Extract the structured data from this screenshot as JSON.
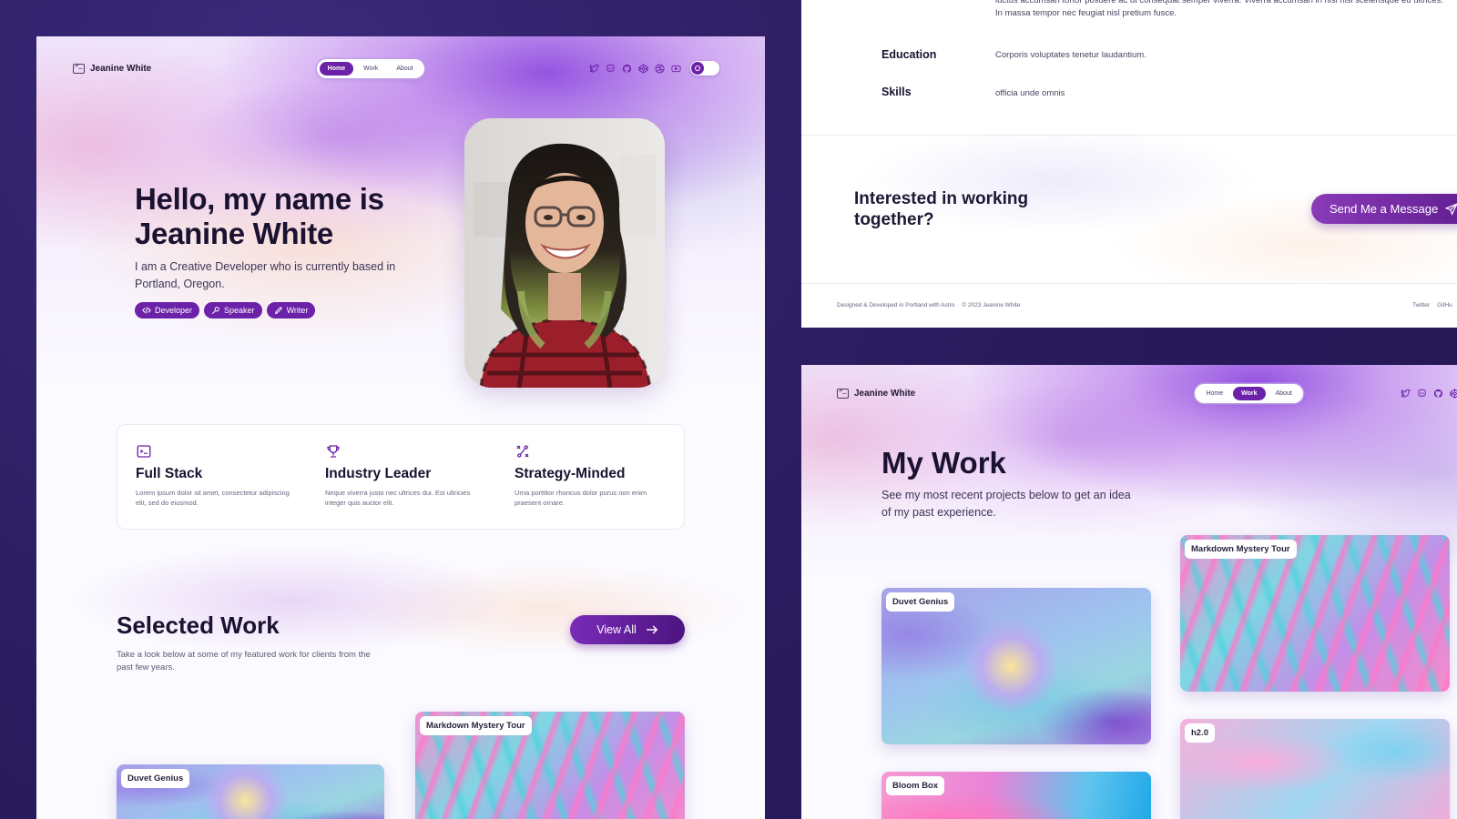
{
  "brand": {
    "name": "Jeanine White"
  },
  "nav": {
    "tabs": [
      "Home",
      "Work",
      "About"
    ]
  },
  "social": [
    "twitter-icon",
    "mastodon-icon",
    "github-icon",
    "codepen-icon",
    "dribbble-icon",
    "youtube-icon"
  ],
  "home": {
    "hero": {
      "title_line1": "Hello, my name is",
      "title_line2": "Jeanine White",
      "subtitle": "I am a Creative Developer who is currently based in Portland, Oregon.",
      "tags": [
        "Developer",
        "Speaker",
        "Writer"
      ]
    },
    "features": [
      {
        "title": "Full Stack",
        "text": "Lorem ipsum dolor sit amet, consectetur adipiscing elit, sed do eiusmod.",
        "icon": "terminal-icon"
      },
      {
        "title": "Industry Leader",
        "text": "Neque viverra justo nec ultrices dui. Est ultricies integer quis auctor elit.",
        "icon": "trophy-icon"
      },
      {
        "title": "Strategy-Minded",
        "text": "Urna porttitor rhoncus dolor purus non enim praesent ornare.",
        "icon": "strategy-icon"
      }
    ],
    "selected_work": {
      "title": "Selected Work",
      "subtitle": "Take a look below at some of my featured work for clients from the past few years.",
      "view_all": "View All"
    },
    "cards": [
      "Duvet Genius",
      "Markdown Mystery Tour"
    ]
  },
  "about": {
    "top_text": "luctus accumsan tortor posuere ac ut consequat semper viverra. Viverra accumsan in nisl nisi scelerisque eu ultrices. In massa tempor nec feugiat nisl pretium fusce.",
    "rows": [
      {
        "label": "Education",
        "value": "Corporis voluptates tenetur laudantium."
      },
      {
        "label": "Skills",
        "value": "officia unde omnis"
      }
    ],
    "cta": {
      "text": "Interested in working together?",
      "button": "Send Me a Message"
    },
    "footer": {
      "credit": "Designed & Developed in Portland with Astro",
      "copyright": "© 2023 Jeanine White",
      "links": [
        "Twitter",
        "GitHu"
      ]
    }
  },
  "work": {
    "title": "My Work",
    "subtitle": "See my most recent projects below to get an idea of my past experience.",
    "cards": [
      "Duvet Genius",
      "Markdown Mystery Tour",
      "Bloom Box",
      "h2.0"
    ]
  },
  "colors": {
    "accent": "#6b21a8",
    "background": "#2e1f66",
    "text": "#1a1230"
  }
}
